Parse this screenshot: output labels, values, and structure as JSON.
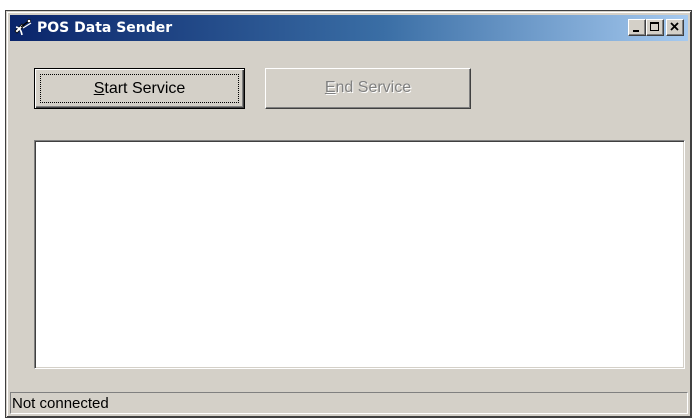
{
  "window": {
    "title": "POS Data Sender",
    "icon": "satellite-dish-icon"
  },
  "caption_buttons": {
    "minimize": "minimize-icon",
    "maximize": "maximize-icon",
    "close": "close-icon"
  },
  "buttons": {
    "start": {
      "mnemonic": "S",
      "rest": "tart Service",
      "enabled": true
    },
    "end": {
      "mnemonic": "E",
      "rest": "nd Service",
      "enabled": false
    }
  },
  "log": {
    "lines": []
  },
  "status": {
    "text": "Not connected"
  },
  "colors": {
    "title_gradient_start": "#0a246a",
    "title_gradient_end": "#a6caf0",
    "face": "#d4d0c8",
    "disabled_text": "#808080"
  }
}
